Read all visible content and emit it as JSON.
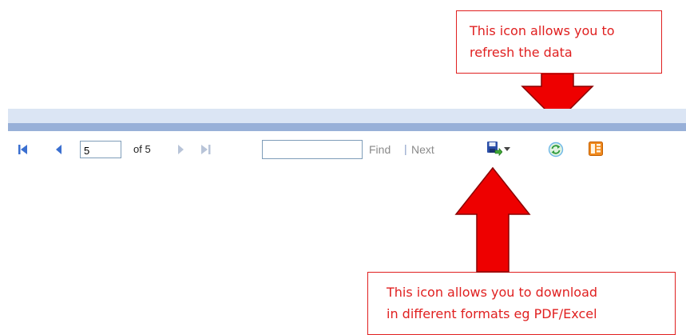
{
  "callouts": {
    "top": {
      "line1": "This icon allows you to",
      "line2": "refresh the data"
    },
    "bottom": {
      "line1": "This icon allows you to download",
      "line2": "in different formats eg PDF/Excel"
    }
  },
  "toolbar": {
    "page_value": "5",
    "page_total": "of 5",
    "find_value": "",
    "find_label": "Find",
    "separator": "|",
    "next_label": "Next",
    "icons": [
      "first-page-icon",
      "previous-page-icon",
      "next-page-icon",
      "last-page-icon",
      "export-save-icon",
      "dropdown-arrow-icon",
      "refresh-icon",
      "document-map-icon"
    ]
  },
  "colors": {
    "callout": "#e02020",
    "arrow": "#ee0000",
    "band_light": "#dbe5f4",
    "band_dark": "#98b0d8",
    "nav_icon": "#3a6fd0"
  }
}
